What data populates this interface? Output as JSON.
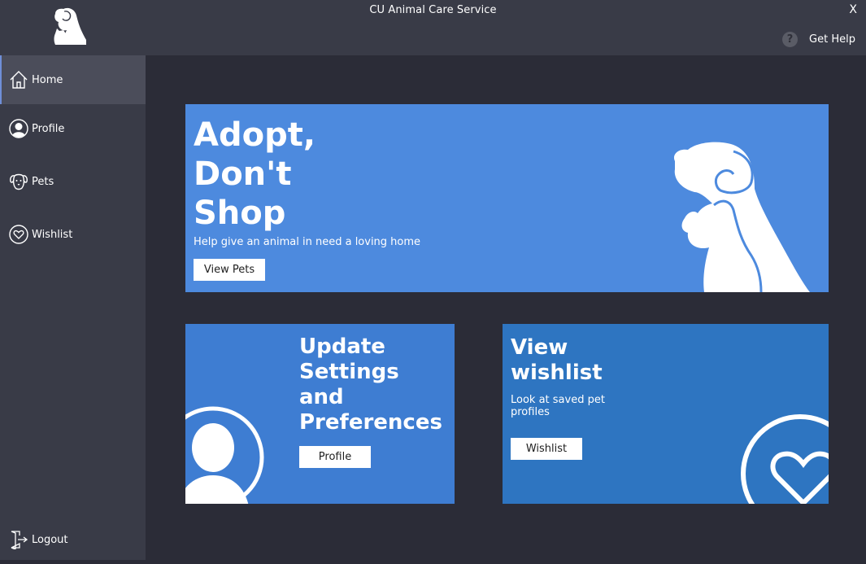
{
  "window": {
    "title": "CU Animal Care Service",
    "close_label": "X",
    "help_label": "Get Help",
    "help_icon_glyph": "?",
    "logo_icon": "dog-cat-logo-icon"
  },
  "sidebar": {
    "items": [
      {
        "label": "Home",
        "icon": "home-icon",
        "active": true
      },
      {
        "label": "Profile",
        "icon": "profile-icon",
        "active": false
      },
      {
        "label": "Pets",
        "icon": "dog-face-icon",
        "active": false
      },
      {
        "label": "Wishlist",
        "icon": "heart-icon",
        "active": false
      }
    ],
    "logout_label": "Logout",
    "logout_icon": "logout-door-icon"
  },
  "hero": {
    "title_line1": "Adopt,",
    "title_line2": "Don't",
    "title_line3": "Shop",
    "subtitle": "Help give an animal in need a loving home",
    "button_label": "View Pets",
    "art_icon": "dog-cat-silhouette-icon"
  },
  "profile_card": {
    "title_line1": "Update",
    "title_line2": "Settings",
    "title_line3": "and",
    "title_line4": "Preferences",
    "button_label": "Profile",
    "art_icon": "user-avatar-icon"
  },
  "wishlist_card": {
    "title_line1": "View",
    "title_line2": "wishlist",
    "subtitle": "Look at saved pet profiles",
    "button_label": "Wishlist",
    "art_icon": "heart-circle-icon"
  },
  "colors": {
    "background": "#2b2c37",
    "panel": "#393b47",
    "active_nav": "#4b4d5a",
    "hero": "#4d8ade",
    "profile_card": "#3e7dd2",
    "wishlist_card": "#2e75c1"
  }
}
